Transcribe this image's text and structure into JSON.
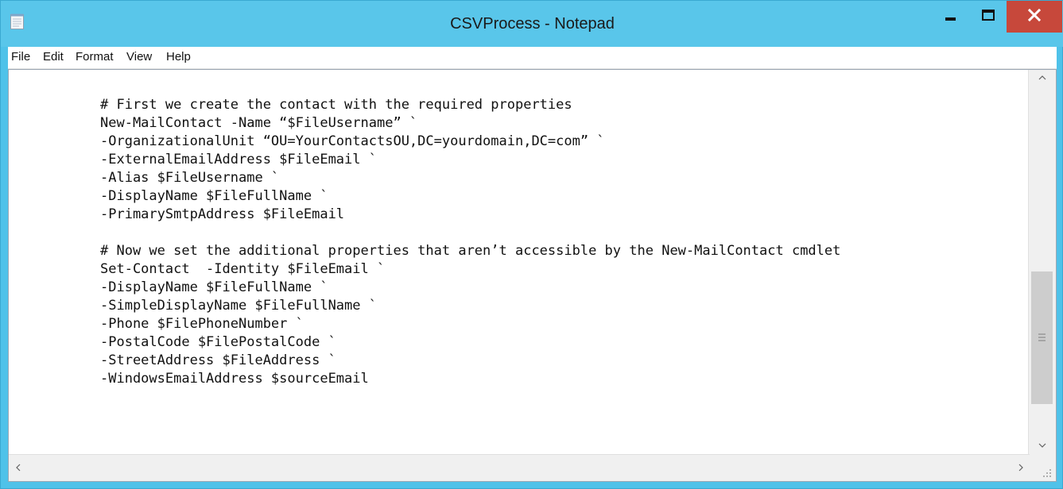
{
  "window": {
    "title": "CSVProcess - Notepad"
  },
  "menu": [
    "File",
    "Edit",
    "Format",
    "View",
    "Help"
  ],
  "editor": {
    "lines": [
      "",
      "# First we create the contact with the required properties",
      "New-MailContact -Name “$FileUsername” `",
      "-OrganizationalUnit “OU=YourContactsOU,DC=yourdomain,DC=com” `",
      "-ExternalEmailAddress $FileEmail `",
      "-Alias $FileUsername `",
      "-DisplayName $FileFullName `",
      "-PrimarySmtpAddress $FileEmail",
      "",
      "# Now we set the additional properties that aren’t accessible by the New-MailContact cmdlet",
      "Set-Contact  -Identity $FileEmail `",
      "-DisplayName $FileFullName `",
      "-SimpleDisplayName $FileFullName `",
      "-Phone $FilePhoneNumber `",
      "-PostalCode $FilePostalCode `",
      "-StreetAddress $FileAddress `",
      "-WindowsEmailAddress $sourceEmail"
    ]
  },
  "icons": {
    "app": "notepad-icon",
    "minimize": "minimize-icon",
    "maximize": "maximize-icon",
    "close": "close-icon"
  },
  "colors": {
    "titlebar": "#59c6ea",
    "close_button": "#c7483b"
  }
}
